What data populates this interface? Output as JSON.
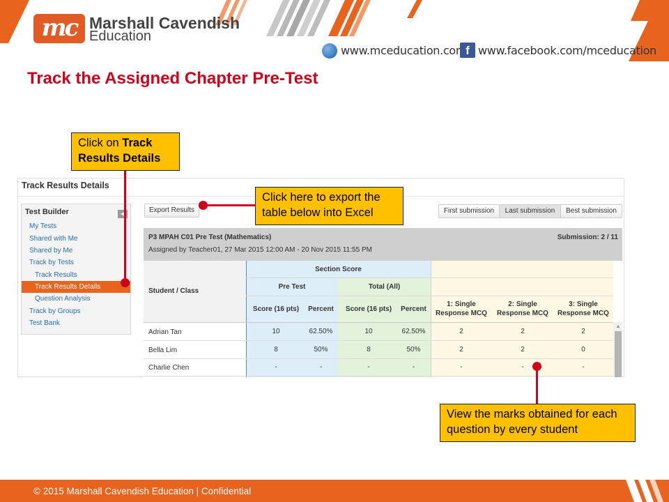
{
  "header": {
    "logo_mark": "mc",
    "brand_line1": "Marshall Cavendish",
    "brand_line2": "Education",
    "website": "www.mceducation.com",
    "facebook": "www.facebook.com/mceducation",
    "globe_icon": "globe-icon",
    "facebook_icon": "facebook-icon"
  },
  "slide_title": "Track the Assigned Chapter Pre-Test",
  "panel": {
    "title": "Track Results Details",
    "sidebar": {
      "heading": "Test Builder",
      "items": [
        {
          "label": "My Tests",
          "level": 0,
          "active": false
        },
        {
          "label": "Shared with Me",
          "level": 0,
          "active": false
        },
        {
          "label": "Shared by Me",
          "level": 0,
          "active": false
        },
        {
          "label": "Track by Tests",
          "level": 0,
          "active": false
        },
        {
          "label": "Track Results",
          "level": 1,
          "active": false
        },
        {
          "label": "Track Results Details",
          "level": 1,
          "active": true
        },
        {
          "label": "Question Analysis",
          "level": 1,
          "active": false
        },
        {
          "label": "Track by Groups",
          "level": 0,
          "active": false
        },
        {
          "label": "Test Bank",
          "level": 0,
          "active": false
        }
      ]
    },
    "export_button": "Export Results",
    "submission_tabs": [
      "First submission",
      "Last submission",
      "Best submission"
    ],
    "selected_submission": "Last submission",
    "test_name": "P3 MPAH C01 Pre Test (Mathematics)",
    "submission_label": "Submission: 2 / 11",
    "assigned_info": "Assigned by Teacher01, 27 Mar 2015 12:00 AM - 20 Nov 2015 11:55 PM",
    "table": {
      "student_header": "Student / Class",
      "section_header": "Section Score",
      "group_pre": "Pre Test",
      "group_total": "Total (All)",
      "col_score_pre": "Score (16 pts)",
      "col_percent_pre": "Percent",
      "col_score_total": "Score (16 pts)",
      "col_percent_total": "Percent",
      "q1_line1": "1: Single",
      "q1_line2": "Response MCQ",
      "q2_line1": "2: Single",
      "q2_line2": "Response MCQ",
      "q3_line1": "3: Single",
      "q3_line2": "Response MCQ",
      "rows": [
        {
          "student": "Adrian Tan",
          "score_pre": "10",
          "percent_pre": "62.50%",
          "score_total": "10",
          "percent_total": "62.50%",
          "q1": "2",
          "q2": "2",
          "q3": "2"
        },
        {
          "student": "Bella Lim",
          "score_pre": "8",
          "percent_pre": "50%",
          "score_total": "8",
          "percent_total": "50%",
          "q1": "2",
          "q2": "2",
          "q3": "0"
        },
        {
          "student": "Charlie Chen",
          "score_pre": "-",
          "percent_pre": "-",
          "score_total": "-",
          "percent_total": "-",
          "q1": "-",
          "q2": "-",
          "q3": "-"
        }
      ]
    }
  },
  "callouts": {
    "track_prefix": "Click on ",
    "track_bold": "Track Results Details",
    "export": "Click here to export the table below into Excel",
    "marks": "View the marks obtained for each question by every student"
  },
  "footer": "© 2015 Marshall Cavendish Education | Confidential",
  "colors": {
    "accent_orange": "#e8641e",
    "title_red": "#d0021b",
    "callout_yellow": "#ffc000",
    "section_blue": "#deeef9",
    "total_green": "#e3f2da",
    "question_yellow": "#fdf8e4"
  }
}
